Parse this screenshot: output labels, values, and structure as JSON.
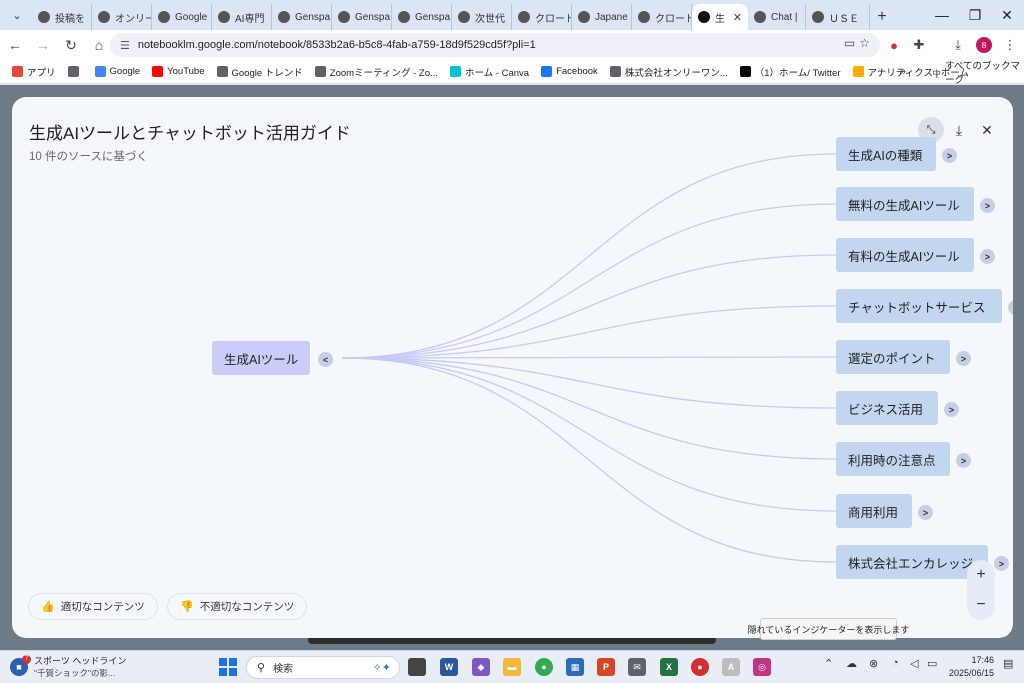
{
  "browser": {
    "tabs": [
      {
        "label": "投稿を",
        "icon": "opera-icon"
      },
      {
        "label": "オンリー",
        "icon": "globe-icon"
      },
      {
        "label": "Google",
        "icon": "gemini-icon"
      },
      {
        "label": "AI専門",
        "icon": "openai-icon"
      },
      {
        "label": "Genspa",
        "icon": "genspark-icon"
      },
      {
        "label": "Genspa",
        "icon": "genspark-icon"
      },
      {
        "label": "Genspa",
        "icon": "genspark-icon"
      },
      {
        "label": "次世代",
        "icon": "claude-icon"
      },
      {
        "label": "クロード",
        "icon": "claude-icon"
      },
      {
        "label": "Japane",
        "icon": "claude-star-icon"
      },
      {
        "label": "クロード",
        "icon": "claude-icon"
      }
    ],
    "active_tab": {
      "label": "生",
      "close": "✕"
    },
    "tabs_after": [
      {
        "label": "Chat |",
        "icon": "chat-icon"
      },
      {
        "label": "ＵＳＥ",
        "icon": "use-icon"
      }
    ],
    "new_tab": "+",
    "url": "notebooklm.google.com/notebook/8533b2a6-b5c8-4fab-a759-18d9f529cd5f?pli=1",
    "profile_initial": "８",
    "bookmarks": [
      {
        "label": "アプリ",
        "color": "#e8453c"
      },
      {
        "label": "",
        "color": "#5f6368"
      },
      {
        "label": "Google",
        "color": "#4285f4"
      },
      {
        "label": "YouTube",
        "color": "#ff0000"
      },
      {
        "label": "Google トレンド",
        "color": "#5f6368"
      },
      {
        "label": "Zoomミーティング - Zo...",
        "color": "#5f6368"
      },
      {
        "label": "ホーム - Canva",
        "color": "#00c4cc"
      },
      {
        "label": "Facebook",
        "color": "#1877f2"
      },
      {
        "label": "株式会社オンリーワン...",
        "color": "#5f6368"
      },
      {
        "label": "（1）ホーム/ Twitter",
        "color": "#000000"
      },
      {
        "label": "アナリティクス | ホーム",
        "color": "#f9ab00"
      }
    ],
    "bookmarks_more": "»",
    "all_bookmarks": "すべてのブックマーク"
  },
  "modal": {
    "title": "生成AIツールとチャットボット活用ガイド",
    "subtitle": "10 件のソースに基づく",
    "root": {
      "label": "生成AIツール",
      "toggle": "<"
    },
    "branches": [
      {
        "label": "生成AIの種類",
        "toggle": ">"
      },
      {
        "label": "無料の生成AIツール",
        "toggle": ">"
      },
      {
        "label": "有料の生成AIツール",
        "toggle": ">"
      },
      {
        "label": "チャットボットサービス",
        "toggle": ">"
      },
      {
        "label": "選定のポイント",
        "toggle": ">"
      },
      {
        "label": "ビジネス活用",
        "toggle": ">"
      },
      {
        "label": "利用時の注意点",
        "toggle": ">"
      },
      {
        "label": "商用利用",
        "toggle": ">"
      },
      {
        "label": "株式会社エンカレッジ",
        "toggle": ">"
      }
    ],
    "feedback_good": "適切なコンテンツ",
    "feedback_bad": "不適切なコンテンツ",
    "zoom_in": "+",
    "zoom_out": "−",
    "link_color": "#c5cbf5"
  },
  "tooltip": "隠れているインジケーターを表示します",
  "taskbar": {
    "news_title": "スポーツ ヘッドライン",
    "news_sub": "\"千賀ショック\"の影...",
    "news_badge": "7",
    "search_placeholder": "検索",
    "time": "17:46",
    "date": "2025/06/15"
  }
}
